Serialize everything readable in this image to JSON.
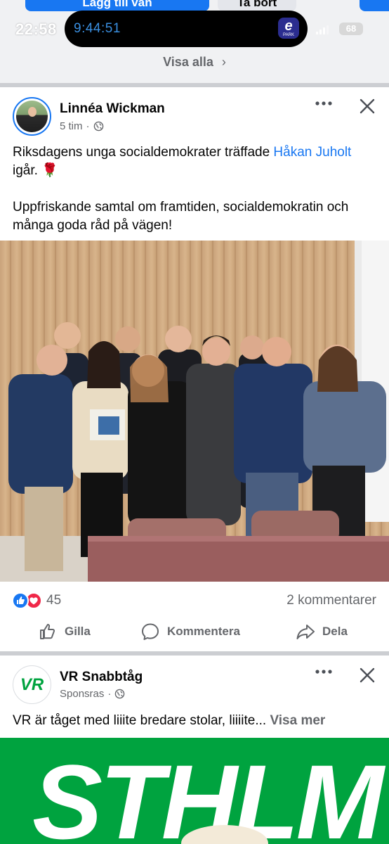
{
  "status_bar": {
    "time": "22:58",
    "live_activity_time": "9:44:51",
    "live_activity_app": "e",
    "live_activity_app_sub": "PARK",
    "battery": "68"
  },
  "friend_suggestions": {
    "add_friend_label": "Lägg till vän",
    "remove_label": "Ta bort",
    "see_all_label": "Visa alla"
  },
  "post": {
    "author": "Linnéa Wickman",
    "time": "5 tim",
    "audience_icon": "globe-icon",
    "text_line1_prefix": "Riksdagens unga socialdemokrater träffade ",
    "mention": "Håkan Juholt",
    "text_line1_suffix": " igår. 🌹",
    "text_paragraph2": "Uppfriskande samtal om framtiden, socialdemokratin och många goda råd på vägen!",
    "reaction_count": "45",
    "comments": "2 kommentarer",
    "actions": {
      "like": "Gilla",
      "comment": "Kommentera",
      "share": "Dela"
    }
  },
  "sponsored": {
    "advertiser": "VR Snabbtåg",
    "logo_text": "VR",
    "label": "Sponsras",
    "text": "VR är tåget med liiite bredare stolar, liiiite...",
    "see_more": "Visa mer",
    "banner_text": "STHLM"
  },
  "colors": {
    "facebook_blue": "#1877f2",
    "love_red": "#f02849",
    "vr_green": "#00a33f",
    "secondary_text": "#65676b"
  }
}
